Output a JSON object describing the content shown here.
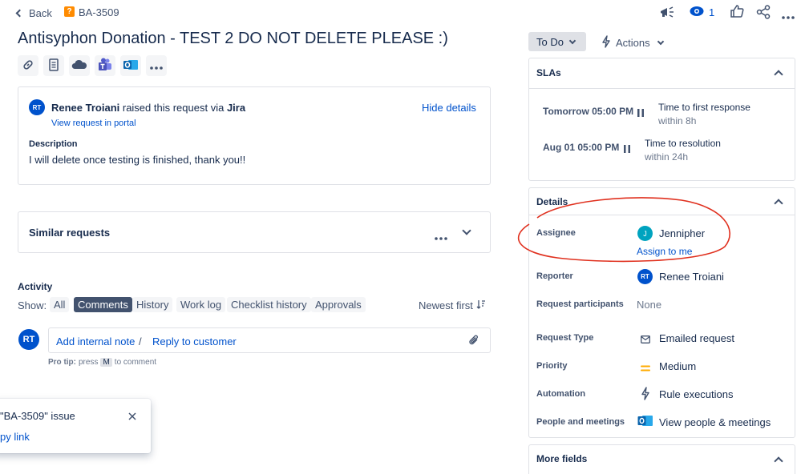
{
  "nav": {
    "back_label": "Back",
    "issue_key": "BA-3509",
    "watch_count": "1"
  },
  "title": "Antisyphon Donation - TEST 2 DO NOT DELETE PLEASE :)",
  "request": {
    "initials": "RT",
    "reporter_name": "Renee Troiani",
    "raised_text": " raised this request via ",
    "channel": "Jira",
    "hide_details": "Hide details",
    "view_portal": "View request in portal",
    "description_label": "Description",
    "description": "I will delete once testing is finished, thank you!!"
  },
  "similar": {
    "label": "Similar requests"
  },
  "activity": {
    "heading": "Activity",
    "show_label": "Show:",
    "tabs": [
      "All",
      "Comments",
      "History",
      "Work log",
      "Checklist history",
      "Approvals"
    ],
    "active_tab": "Comments",
    "sort": "Newest first",
    "user_initials": "RT",
    "add_internal_note": "Add internal note",
    "separator": "/",
    "reply_to_customer": "Reply to customer",
    "pro_tip_label": "Pro tip:",
    "pro_tip_press": "press",
    "pro_tip_key": "M",
    "pro_tip_suffix": "to comment"
  },
  "toast": {
    "title": "\"BA-3509\" issue",
    "link": "py link"
  },
  "status": {
    "label": "To Do",
    "actions": "Actions"
  },
  "slas": {
    "heading": "SLAs",
    "items": [
      {
        "time": "Tomorrow 05:00 PM",
        "goal": "Time to first response",
        "within": "within 8h"
      },
      {
        "time": "Aug 01 05:00 PM",
        "goal": "Time to resolution",
        "within": "within 24h"
      }
    ]
  },
  "details": {
    "heading": "Details",
    "assignee_label": "Assignee",
    "assignee_initial": "J",
    "assignee": "Jennipher",
    "assign_to_me": "Assign to me",
    "reporter_label": "Reporter",
    "reporter_initials": "RT",
    "reporter": "Renee Troiani",
    "participants_label": "Request participants",
    "participants": "None",
    "request_type_label": "Request Type",
    "request_type": "Emailed request",
    "priority_label": "Priority",
    "priority": "Medium",
    "automation_label": "Automation",
    "automation": "Rule executions",
    "people_label": "People and meetings",
    "people": "View people & meetings"
  },
  "more_fields": {
    "heading": "More fields"
  },
  "colors": {
    "accent": "#0052cc",
    "annotation": "#e0301e",
    "priority": "#ffab00",
    "teal_avatar": "#00a3bf"
  }
}
